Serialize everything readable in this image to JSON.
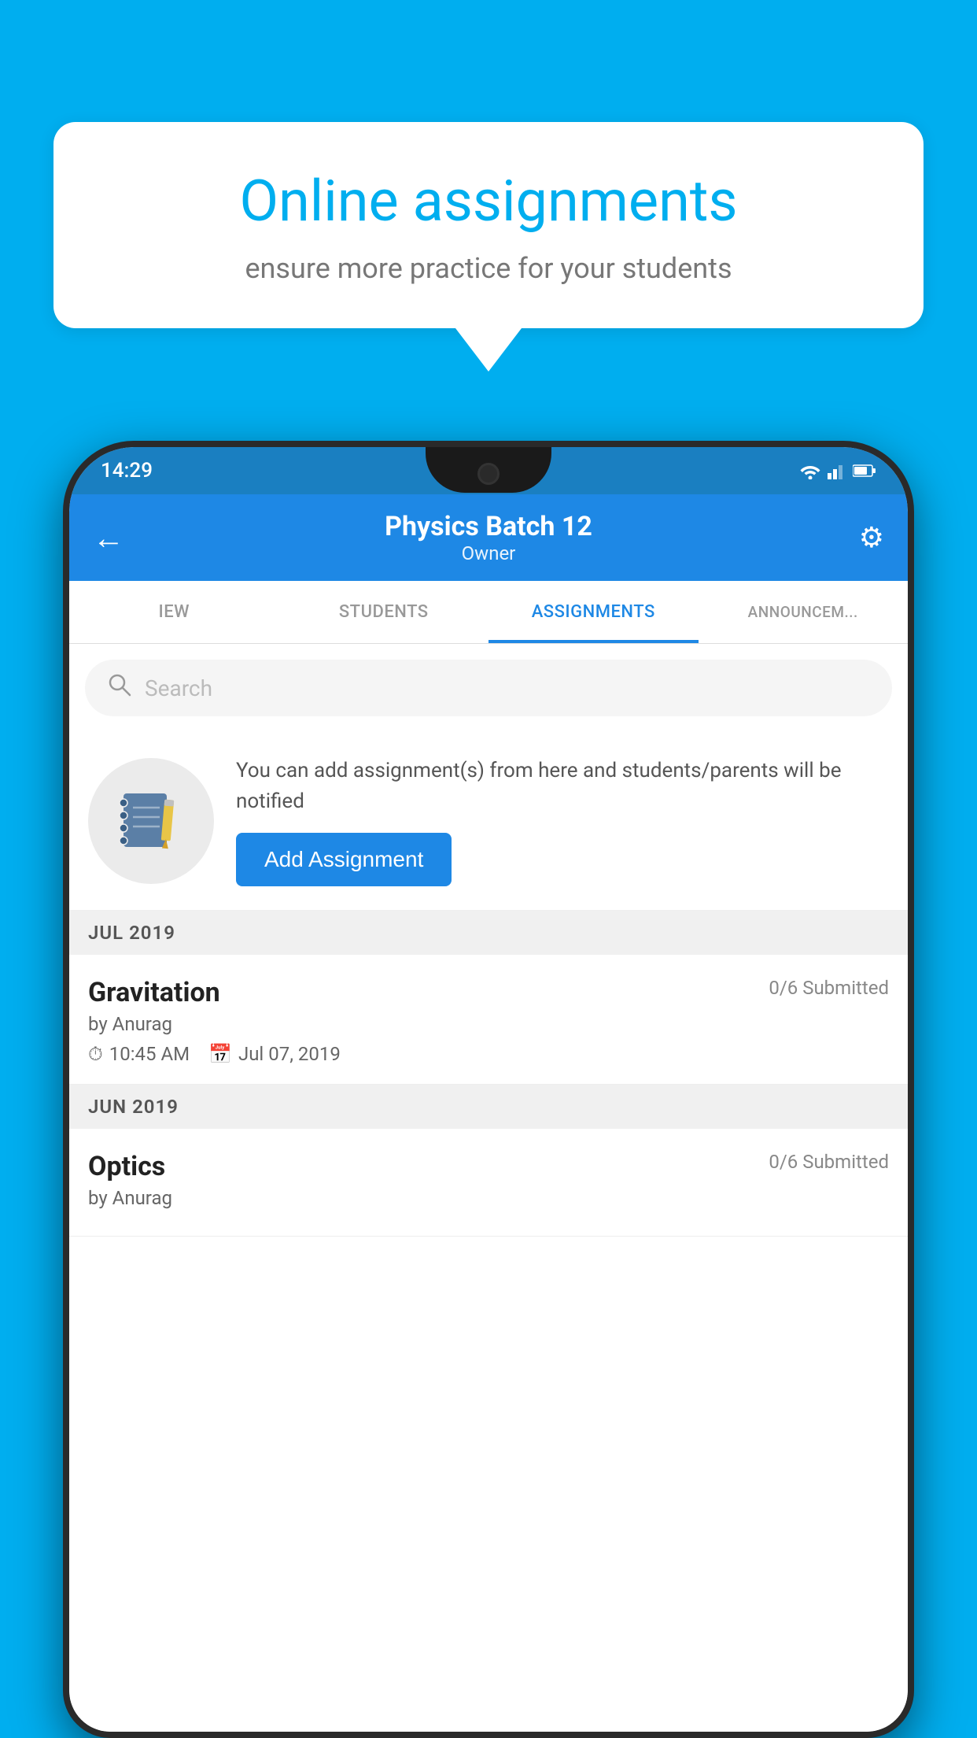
{
  "background_color": "#00AEEF",
  "speech_bubble": {
    "title": "Online assignments",
    "subtitle": "ensure more practice for your students"
  },
  "status_bar": {
    "time": "14:29"
  },
  "app_bar": {
    "title": "Physics Batch 12",
    "subtitle": "Owner",
    "back_label": "←",
    "settings_label": "⚙"
  },
  "tabs": [
    {
      "label": "IEW",
      "active": false
    },
    {
      "label": "STUDENTS",
      "active": false
    },
    {
      "label": "ASSIGNMENTS",
      "active": true
    },
    {
      "label": "ANNOUNCEM...",
      "active": false
    }
  ],
  "search": {
    "placeholder": "Search"
  },
  "promo": {
    "text": "You can add assignment(s) from here and students/parents will be notified",
    "button_label": "Add Assignment"
  },
  "sections": [
    {
      "header": "JUL 2019",
      "assignments": [
        {
          "title": "Gravitation",
          "submitted": "0/6 Submitted",
          "author": "by Anurag",
          "time": "10:45 AM",
          "date": "Jul 07, 2019"
        }
      ]
    },
    {
      "header": "JUN 2019",
      "assignments": [
        {
          "title": "Optics",
          "submitted": "0/6 Submitted",
          "author": "by Anurag",
          "time": "",
          "date": ""
        }
      ]
    }
  ]
}
